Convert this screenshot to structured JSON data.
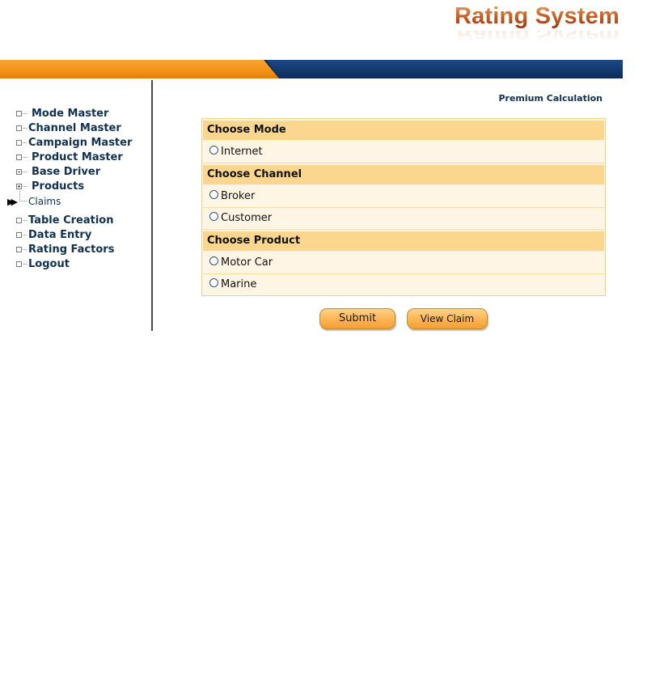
{
  "header": {
    "app_title": "Rating System"
  },
  "sidebar": {
    "items": [
      {
        "label": "Mode Master",
        "icon": "square-node-icon"
      },
      {
        "label": "Channel Master",
        "icon": "square-node-icon"
      },
      {
        "label": "Campaign Master",
        "icon": "square-node-icon"
      },
      {
        "label": "Product Master",
        "icon": "square-node-icon"
      },
      {
        "label": "Base Driver",
        "icon": "collapse-minus-icon"
      },
      {
        "label": "Products",
        "icon": "expand-plus-icon"
      },
      {
        "label": "Claims",
        "icon": "pointer-arrow-icon"
      },
      {
        "label": "Table Creation",
        "icon": "square-node-icon"
      },
      {
        "label": "Data Entry",
        "icon": "square-node-icon"
      },
      {
        "label": "Rating Factors",
        "icon": "square-node-icon"
      },
      {
        "label": "Logout",
        "icon": "square-node-icon"
      }
    ]
  },
  "main": {
    "page_title": "Premium Calculation",
    "sections": [
      {
        "heading": "Choose Mode",
        "options": [
          "Internet"
        ]
      },
      {
        "heading": "Choose Channel",
        "options": [
          "Broker",
          "Customer"
        ]
      },
      {
        "heading": "Choose Product",
        "options": [
          "Motor Car",
          "Marine"
        ]
      }
    ],
    "buttons": {
      "submit_label": "Submit",
      "view_claim_label": "View Claim"
    }
  },
  "colors": {
    "accent_orange": "#f39118",
    "brand_navy": "#0f2f60",
    "section_header_bg": "#fbd68f",
    "option_row_bg": "#fef5e4",
    "button_orange": "#fbb452"
  }
}
